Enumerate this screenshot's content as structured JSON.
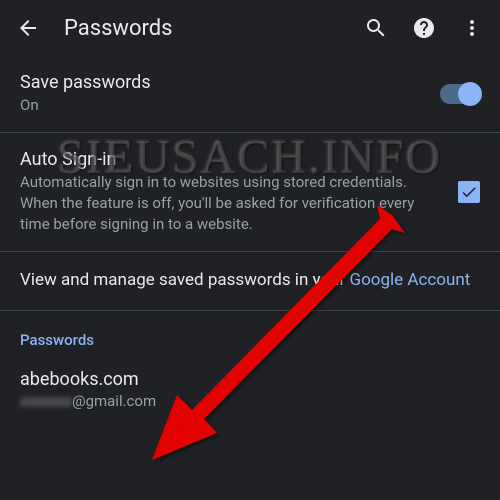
{
  "header": {
    "title": "Passwords"
  },
  "savePasswords": {
    "title": "Save passwords",
    "status": "On"
  },
  "autoSignIn": {
    "title": "Auto Sign-in",
    "description": "Automatically sign in to websites using stored credentials. When the feature is off, you'll be asked for verification every time before signing in to a website."
  },
  "manageLink": {
    "text": "View and manage saved passwords in your ",
    "linkText": "Google Account"
  },
  "passwordsSection": {
    "header": "Passwords",
    "items": [
      {
        "site": "abebooks.com",
        "emailPrefix": "xxxxxxx",
        "emailSuffix": "@gmail.com"
      }
    ]
  },
  "watermark": "SIEUSACH.INFO"
}
